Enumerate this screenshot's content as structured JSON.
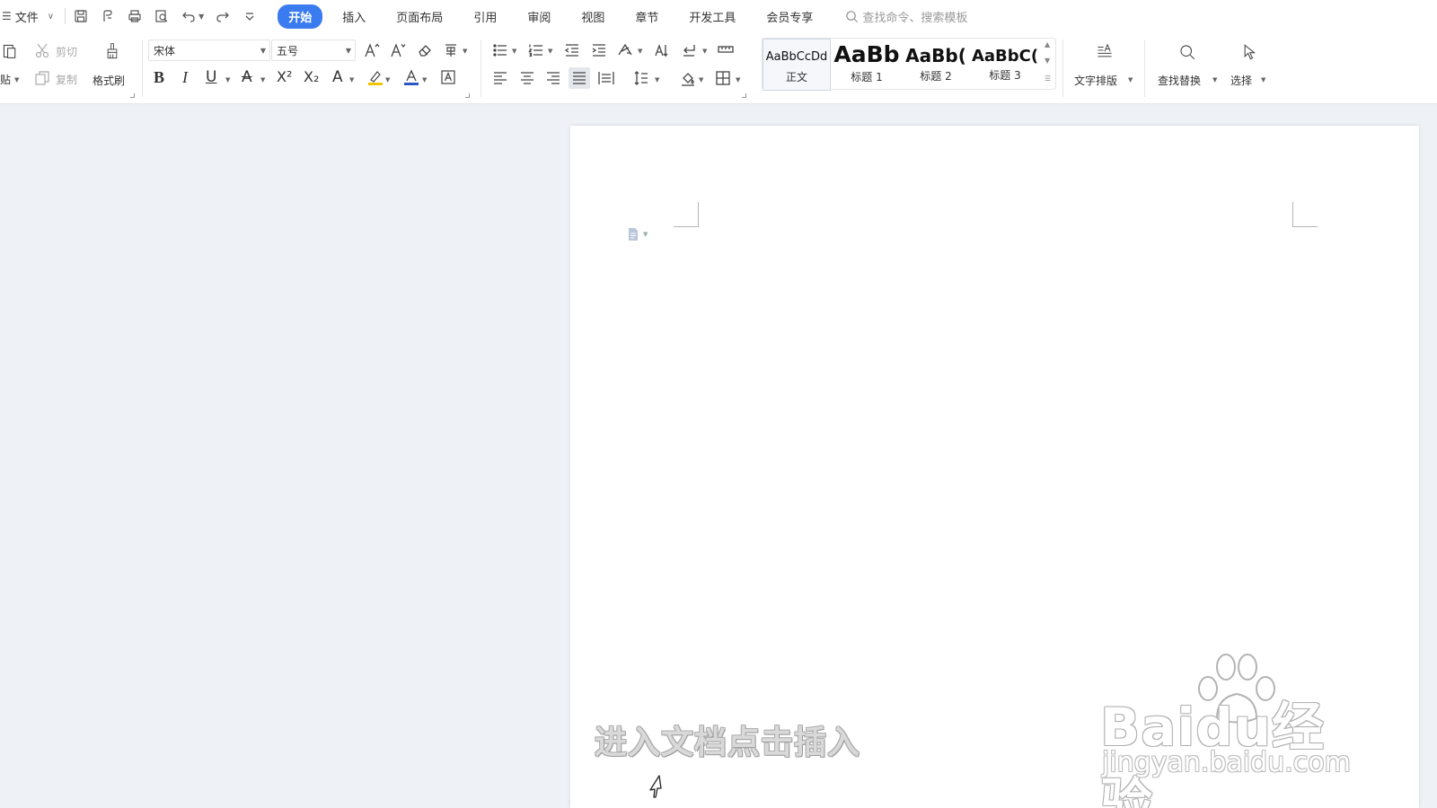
{
  "menubar": {
    "file_label": "文件",
    "tabs": [
      {
        "label": "开始",
        "active": true
      },
      {
        "label": "插入"
      },
      {
        "label": "页面布局"
      },
      {
        "label": "引用"
      },
      {
        "label": "审阅"
      },
      {
        "label": "视图"
      },
      {
        "label": "章节"
      },
      {
        "label": "开发工具"
      },
      {
        "label": "会员专享"
      }
    ],
    "search_placeholder": "查找命令、搜索模板"
  },
  "ribbon": {
    "paste_label": "贴",
    "cut_label": "剪切",
    "copy_label": "复制",
    "format_painter_label": "格式刷",
    "font_name": "宋体",
    "font_size": "五号",
    "styles": [
      {
        "preview": "AaBbCcDd",
        "name": "正文"
      },
      {
        "preview": "AaBb",
        "name": "标题 1"
      },
      {
        "preview": "AaBb(",
        "name": "标题 2"
      },
      {
        "preview": "AaBbC(",
        "name": "标题 3"
      }
    ],
    "text_layout_label": "文字排版",
    "find_replace_label": "查找替换",
    "select_label": "选择",
    "accent_color": "#3a7bf0",
    "highlight_color": "#f5c400",
    "font_color": "#2a56c6"
  },
  "document": {
    "caption": "进入文档点击插入"
  },
  "watermark": {
    "logo_text": "Baidu经验",
    "site_text": "jingyan.baidu.com"
  }
}
